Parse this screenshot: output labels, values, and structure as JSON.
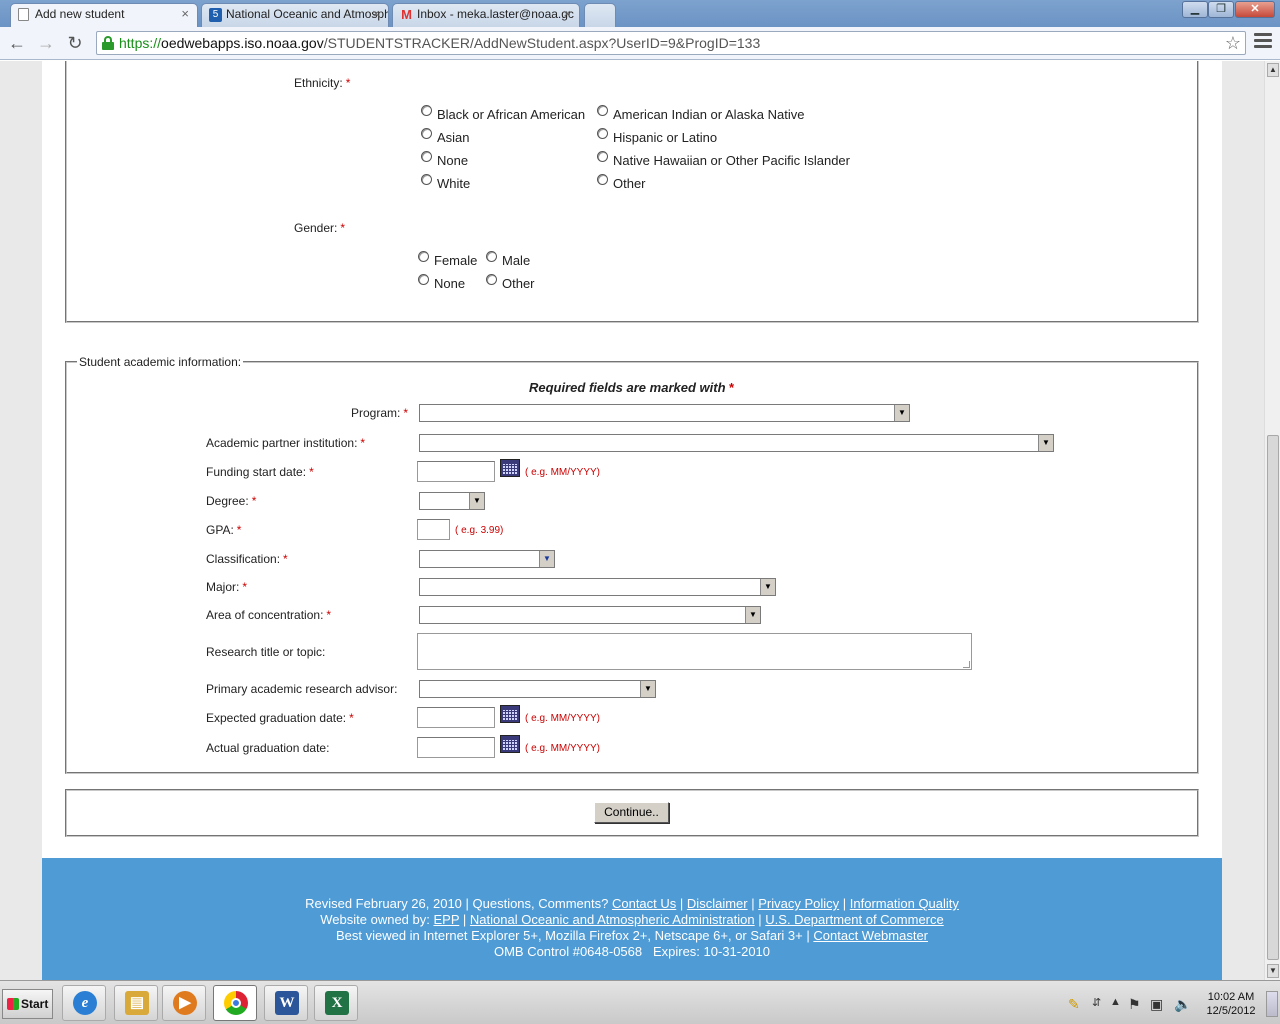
{
  "browser": {
    "tabs": [
      {
        "label": "Add new student",
        "icon": "page-icon"
      },
      {
        "label": "National Oceanic and Atmosph",
        "icon": "noaa-favicon-5"
      },
      {
        "label": "Inbox - meka.laster@noaa.gc",
        "icon": "gmail-icon"
      }
    ],
    "close_symbol": "×",
    "url": {
      "protocol": "https://",
      "host": "oedwebapps.iso.noaa.gov",
      "path": "/STUDENTSTRACKER/AddNewStudent.aspx?UserID=9&ProgID=133"
    },
    "window_buttons": {
      "minimize": "▁",
      "maximize": "❐",
      "close": "✕"
    },
    "nav": {
      "back": "←",
      "forward": "→",
      "reload": "↻",
      "star": "☆"
    }
  },
  "form": {
    "required_mark": "*",
    "ethnicity": {
      "label": "Ethnicity:",
      "options_col1": [
        "Black or African American",
        "Asian",
        "None",
        "White"
      ],
      "options_col2": [
        "American Indian or Alaska Native",
        "Hispanic or Latino",
        "Native Hawaiian or Other Pacific Islander",
        "Other"
      ]
    },
    "gender": {
      "label": "Gender:",
      "options": [
        "Female",
        "Male",
        "None",
        "Other"
      ]
    },
    "academic": {
      "legend": "Student academic information:",
      "required_note": "Required fields are marked with",
      "program": "Program:",
      "partner": "Academic partner institution:",
      "funding_start": "Funding start date:",
      "degree": "Degree:",
      "gpa": "GPA:",
      "classification": "Classification:",
      "major": "Major:",
      "concentration": "Area of concentration:",
      "research_topic": "Research title or topic:",
      "advisor": "Primary academic research advisor:",
      "expected_grad": "Expected graduation date:",
      "actual_grad": "Actual graduation date:",
      "date_hint": "( e.g. MM/YYYY)",
      "gpa_hint": "( e.g. 3.99)"
    },
    "continue_label": "Continue.."
  },
  "footer": {
    "line1_text": "Revised February 26, 2010 | Questions, Comments?",
    "contact_us": "Contact Us",
    "disclaimer": "Disclaimer",
    "privacy": "Privacy Policy",
    "info_quality": "Information Quality",
    "line2_text": "Website owned by:",
    "epp": "EPP",
    "noaa": "National Oceanic and Atmospheric Administration",
    "doc": "U.S. Department of Commerce",
    "line3_text": "Best viewed in Internet Explorer 5+, Mozilla Firefox 2+, Netscape 6+, or Safari 3+ |",
    "webmaster": "Contact Webmaster",
    "line4_text": "OMB Control #0648-0568   Expires: 10-31-2010",
    "separator": "|"
  },
  "taskbar": {
    "start": "Start",
    "apps": [
      {
        "name": "internet-explorer-icon",
        "glyph": "e",
        "color": "#2a7fd4"
      },
      {
        "name": "file-explorer-icon",
        "glyph": "▤",
        "color": "#d9a93a"
      },
      {
        "name": "media-player-icon",
        "glyph": "▶",
        "color": "#e07a1f"
      },
      {
        "name": "chrome-icon",
        "glyph": "◉",
        "color": "#d23"
      },
      {
        "name": "word-icon",
        "glyph": "W",
        "color": "#2b579a"
      },
      {
        "name": "excel-icon",
        "glyph": "X",
        "color": "#217346"
      }
    ],
    "clock_time": "10:02 AM",
    "clock_date": "12/5/2012"
  }
}
